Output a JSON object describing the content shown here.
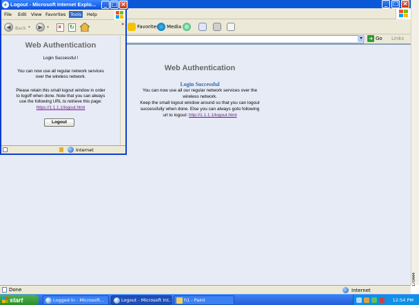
{
  "main": {
    "toolbar": {
      "favorites": "Favorites",
      "media": "Media"
    },
    "go": "Go",
    "links": "Links",
    "page": {
      "title": "Web Authentication",
      "subtitle": "Login Successful",
      "line1": "You can now use all our regular network services over the",
      "line2": "wireless network.",
      "line3": "Keep the small logout window around so that you can logout",
      "line4": "successfully when done. Else you can always goto following",
      "line5_prefix": "url to logout:",
      "link": "http://1.1.1.1/logout.html"
    },
    "status": {
      "done": "Done",
      "zone": "Internet"
    }
  },
  "popup": {
    "title": "Logout - Microsoft Internet Explo...",
    "menu": [
      "File",
      "Edit",
      "View",
      "Favorites",
      "Tools",
      "Help"
    ],
    "back": "Back",
    "page": {
      "heading": "Web Authentication",
      "login": "Login Successful !",
      "p1a": "You can now use all regular network services",
      "p1b": "over the wireless network.",
      "p2a": "Please retain this small logout window in order",
      "p2b": "to logoff when done. Note that you can always",
      "p2c": "use the following URL to retrieve this page:",
      "link": "https://1.1.1.1/logout.html",
      "button": "Logout"
    },
    "status": {
      "zone": "Internet"
    }
  },
  "taskbar": {
    "start": "start",
    "tasks": [
      "Logged In - Microsoft...",
      "Logout - Microsoft Int...",
      "h1 - Paint"
    ],
    "time": "12:54 PM"
  },
  "figure_code": "170444"
}
